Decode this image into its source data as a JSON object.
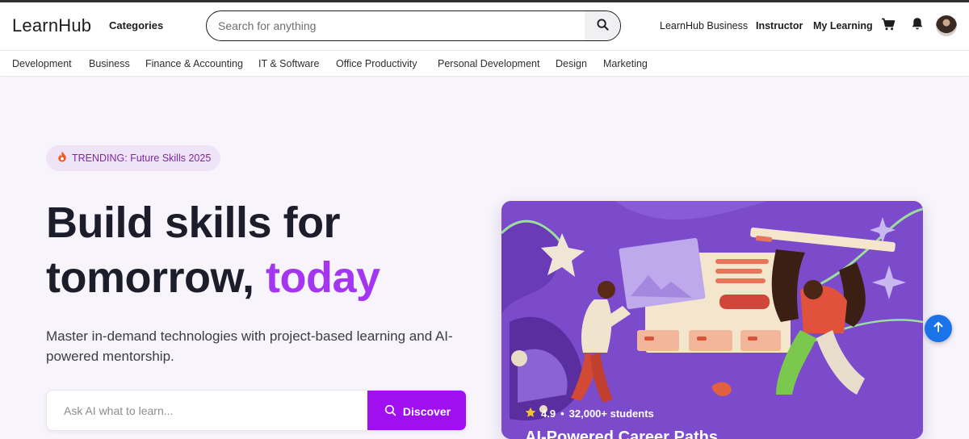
{
  "header": {
    "logo": "LearnHub",
    "categories_label": "Categories",
    "search_placeholder": "Search for anything",
    "links": {
      "business": "LearnHub Business",
      "instructor": "Instructor",
      "my_learning": "My Learning"
    },
    "icons": [
      "search-icon",
      "cart-icon",
      "bell-icon",
      "avatar"
    ]
  },
  "category_nav": [
    "Development",
    "Business",
    "Finance & Accounting",
    "IT & Software",
    "Office Productivity",
    "Personal Development",
    "Design",
    "Marketing"
  ],
  "hero": {
    "badge": "TRENDING: Future Skills 2025",
    "badge_icon": "fire-icon",
    "title_line1": "Build skills for",
    "title_line2_prefix": "tomorrow, ",
    "title_line2_accent": "today",
    "subtitle": "Master in-demand technologies with project-based learning and AI-powered mentorship.",
    "ask_placeholder": "Ask AI what to learn...",
    "discover_label": "Discover"
  },
  "featured_card": {
    "rating": "4.9",
    "students": "32,000+ students",
    "title": "AI-Powered Career Paths"
  },
  "colors": {
    "accent": "#a435f0",
    "button": "#a00ff0",
    "hero_bg": "#f7f4fb",
    "badge_bg": "#efe3f8",
    "card_bg": "#7a47c9",
    "fab": "#1a73e8"
  }
}
